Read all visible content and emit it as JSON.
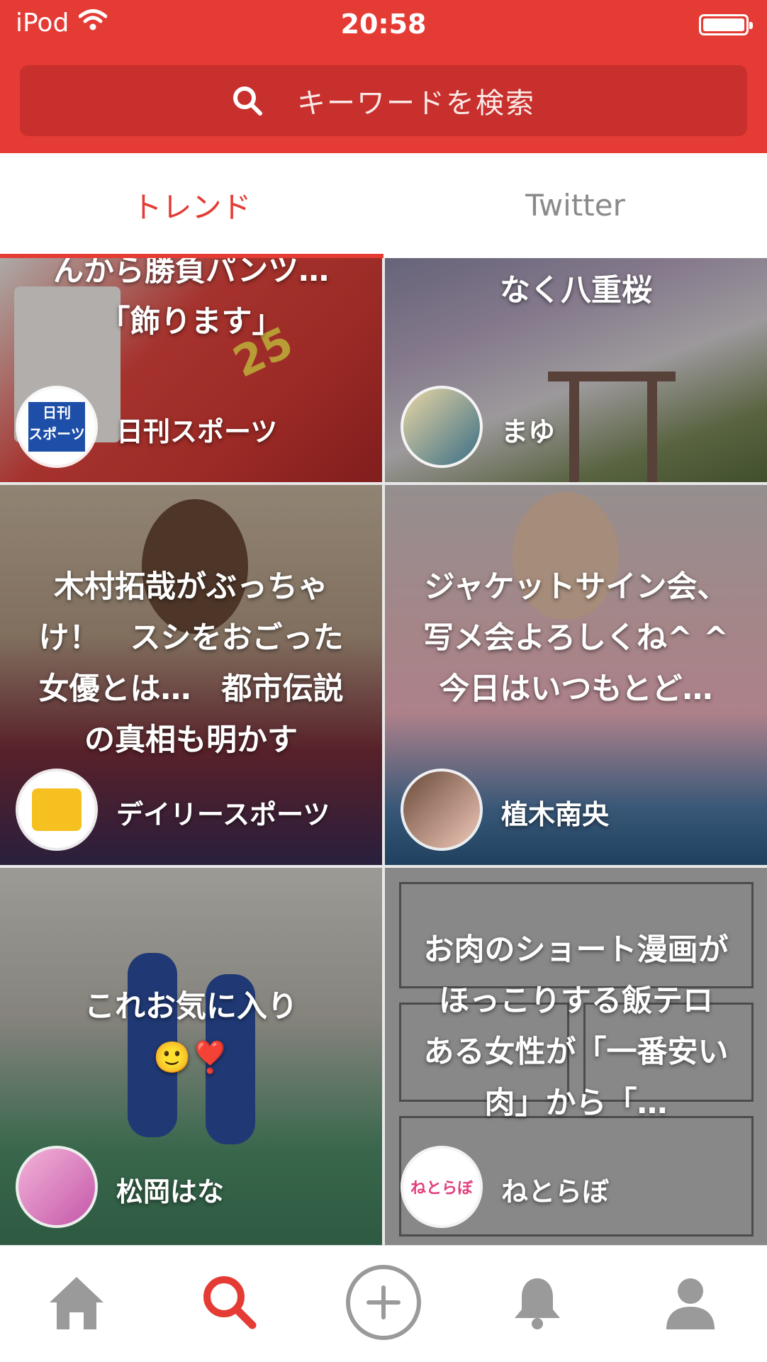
{
  "status_bar": {
    "carrier": "iPod",
    "time": "20:58"
  },
  "search": {
    "placeholder": "キーワードを検索"
  },
  "tabs": [
    {
      "label": "トレンド",
      "active": true
    },
    {
      "label": "Twitter",
      "active": false
    }
  ],
  "cards": [
    {
      "title": "んから勝負パンツ…\n「飾ります」",
      "author": "日刊スポーツ",
      "avatar_icon": "nikkan-sports-logo-icon",
      "avatar_text": "日刊\nスポーツ"
    },
    {
      "title": "なく八重桜",
      "author": "まゆ",
      "avatar_icon": "user-avatar-icon"
    },
    {
      "title": "木村拓哉がぶっちゃけ！　スシをおごった女優とは…　都市伝説の真相も明かす",
      "author": "デイリースポーツ",
      "avatar_icon": "daily-sports-logo-icon"
    },
    {
      "title": "ジャケットサイン会、写メ会よろしくね^ ^\n今日はいつもとど…",
      "author": "植木南央",
      "avatar_icon": "user-avatar-icon"
    },
    {
      "title": "これお気に入り\n🙂❣️",
      "author": "松岡はな",
      "avatar_icon": "user-avatar-icon"
    },
    {
      "title": "お肉のショート漫画がほっこりする飯テロ　ある女性が「一番安い肉」から「…",
      "author": "ねとらぼ",
      "avatar_icon": "netorabo-logo-icon",
      "avatar_text": "ねとらぼ"
    }
  ],
  "bottom_nav": [
    {
      "name": "home",
      "icon": "home-icon",
      "active": false
    },
    {
      "name": "search",
      "icon": "search-icon",
      "active": true
    },
    {
      "name": "post",
      "icon": "plus-circle-icon",
      "active": false
    },
    {
      "name": "notifications",
      "icon": "bell-icon",
      "active": false
    },
    {
      "name": "profile",
      "icon": "user-icon",
      "active": false
    }
  ],
  "colors": {
    "accent": "#e53b35",
    "search_bg": "#c7302c",
    "nav_inactive": "#9a9a9a"
  }
}
